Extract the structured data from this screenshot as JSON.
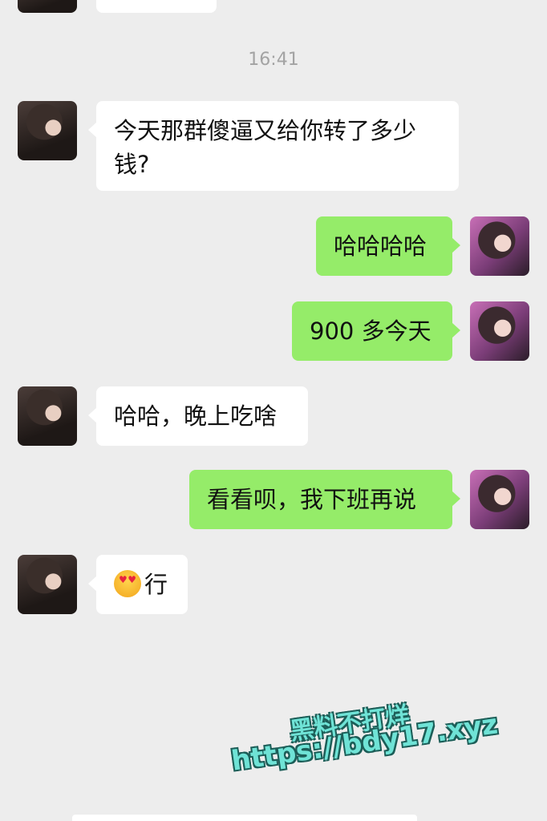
{
  "timestamp": "16:41",
  "messages": [
    {
      "side": "left",
      "text": "今天那群傻逼又给你转了多少钱?"
    },
    {
      "side": "right",
      "text": "哈哈哈哈"
    },
    {
      "side": "right",
      "text": "900 多今天"
    },
    {
      "side": "left",
      "text": "哈哈，晚上吃啥"
    },
    {
      "side": "right",
      "text": "看看呗，我下班再说"
    },
    {
      "side": "left",
      "emoji": "heart-eyes-emoji",
      "text": "行"
    }
  ],
  "watermark": {
    "line1": "黑料不打烊",
    "line2": "https://bdy17.xyz"
  },
  "colors": {
    "background": "#ededed",
    "incoming_bubble": "#ffffff",
    "outgoing_bubble": "#95ec69",
    "watermark": "#6fe3d6"
  }
}
